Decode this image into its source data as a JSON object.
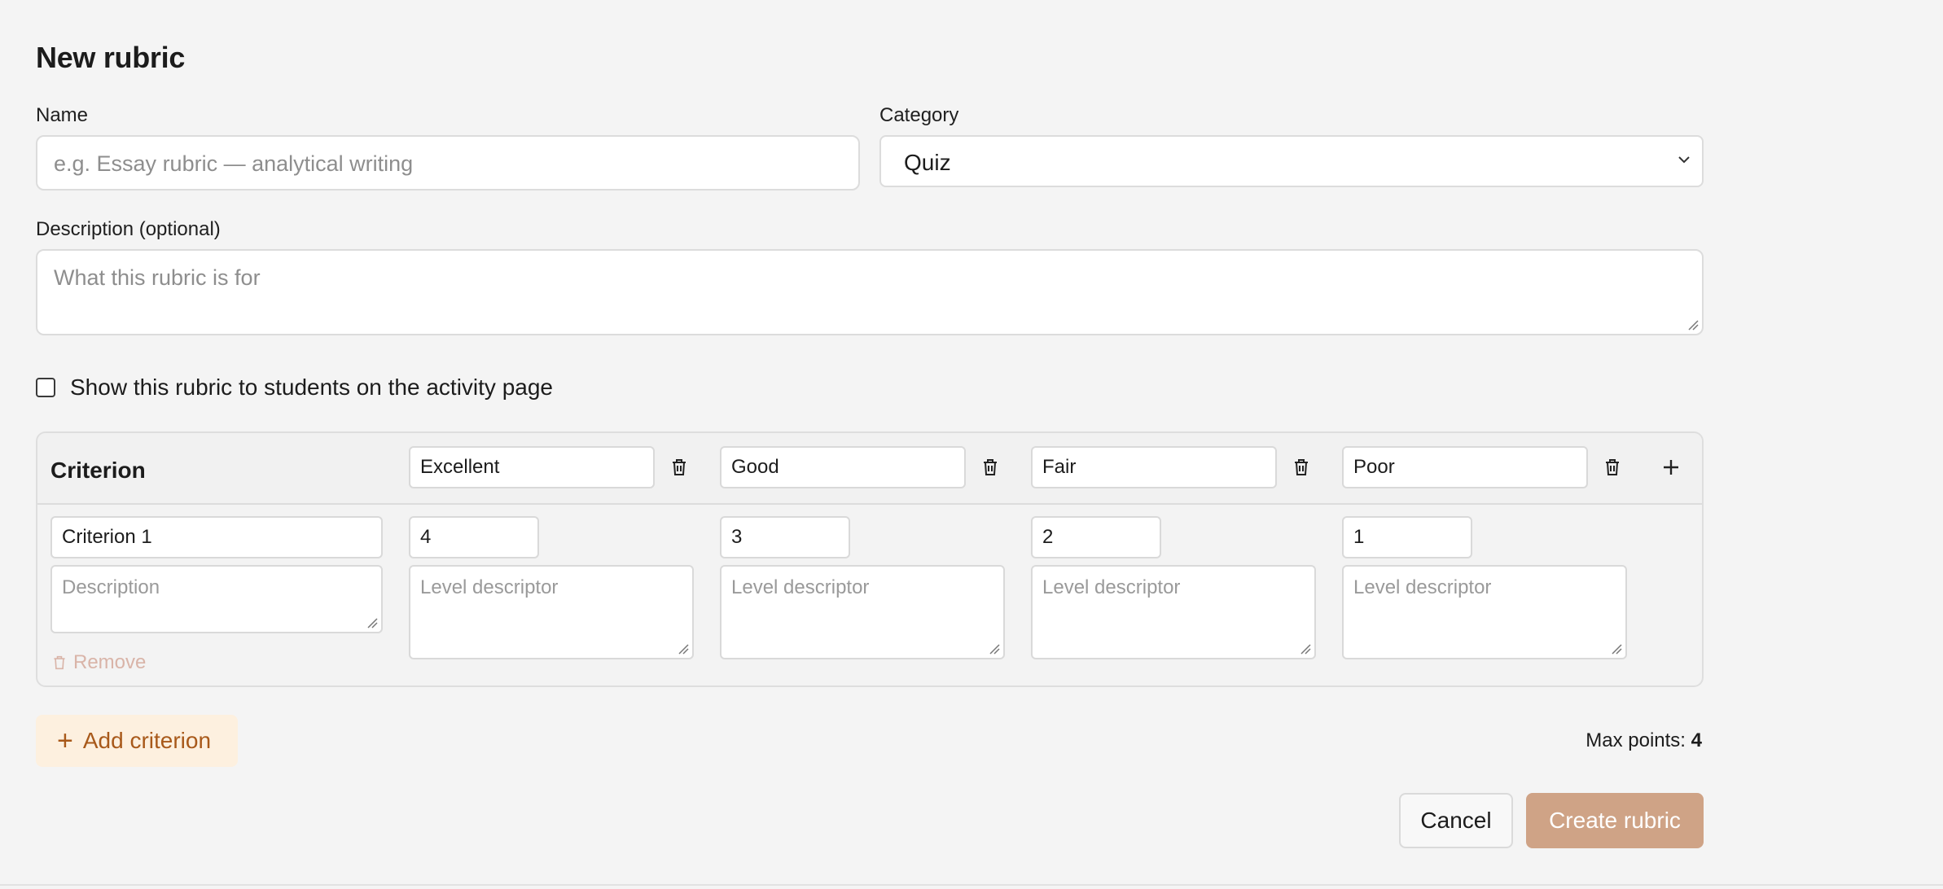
{
  "form": {
    "title": "New rubric",
    "name_label": "Name",
    "name_placeholder": "e.g. Essay rubric — analytical writing",
    "category_label": "Category",
    "category_value": "Quiz",
    "description_label": "Description (optional)",
    "description_placeholder": "What this rubric is for",
    "show_students_label": "Show this rubric to students on the activity page",
    "show_students_checked": false
  },
  "rubric": {
    "criterion_header": "Criterion",
    "levels": [
      {
        "name": "Excellent",
        "points": "4",
        "descriptor_placeholder": "Level descriptor"
      },
      {
        "name": "Good",
        "points": "3",
        "descriptor_placeholder": "Level descriptor"
      },
      {
        "name": "Fair",
        "points": "2",
        "descriptor_placeholder": "Level descriptor"
      },
      {
        "name": "Poor",
        "points": "1",
        "descriptor_placeholder": "Level descriptor"
      }
    ],
    "criteria": [
      {
        "name": "Criterion 1",
        "description_placeholder": "Description",
        "remove_label": "Remove"
      }
    ]
  },
  "footer": {
    "add_criterion_label": "Add criterion",
    "max_points_label": "Max points:",
    "max_points_value": "4",
    "cancel_label": "Cancel",
    "create_label": "Create rubric"
  },
  "colors": {
    "accent": "#cfa386",
    "add_button_bg": "#fdf0df",
    "add_button_text": "#a8591a",
    "remove_text": "#d9b4a8"
  },
  "icons": {
    "level_delete": "trash-icon",
    "add_level": "plus-icon",
    "category_dropdown": "chevron-down-icon",
    "remove_criterion": "trash-icon"
  }
}
